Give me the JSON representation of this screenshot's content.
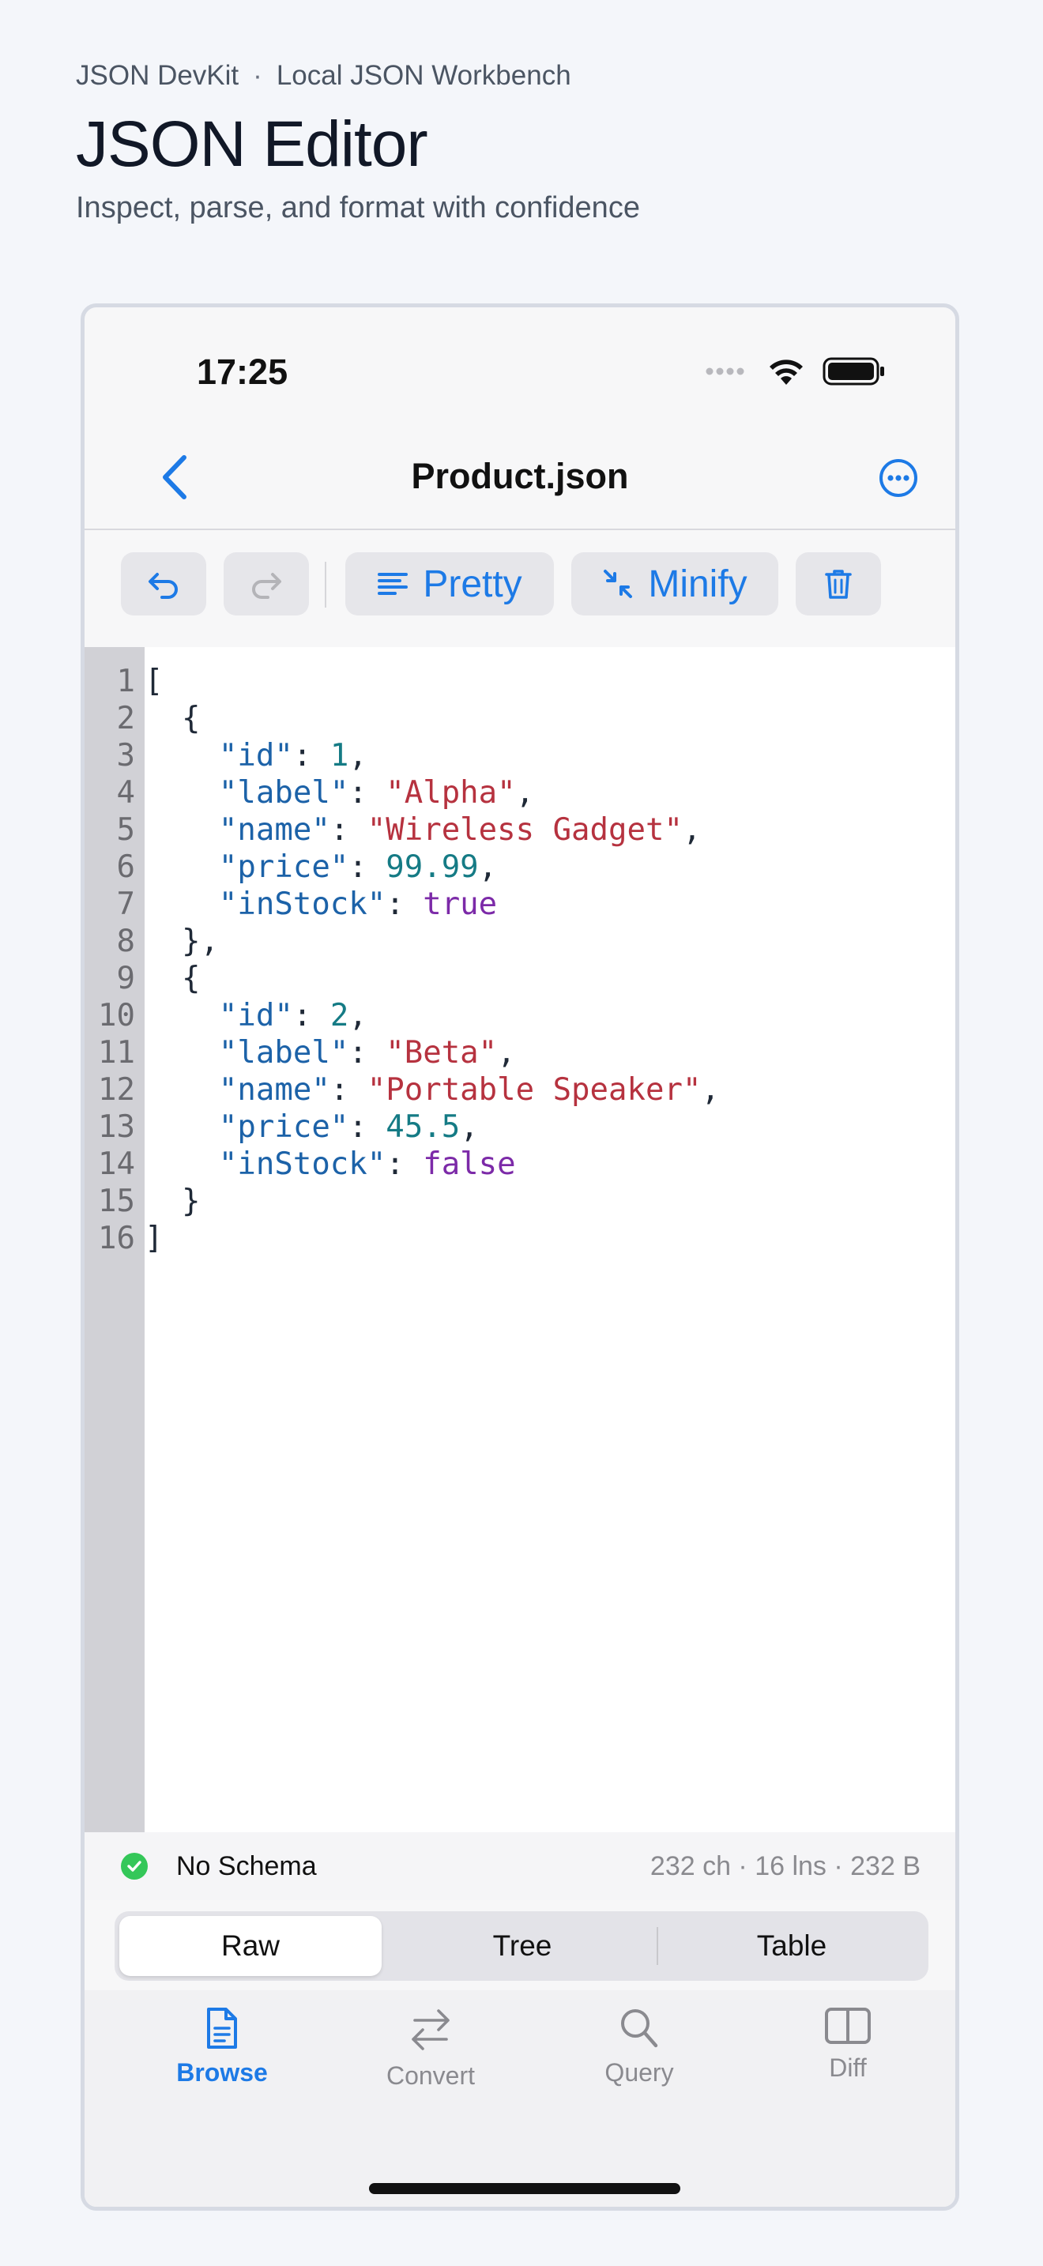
{
  "header": {
    "app_name": "JSON DevKit",
    "separator": "·",
    "section": "Local JSON Workbench",
    "title": "JSON Editor",
    "subtitle": "Inspect, parse, and format with confidence"
  },
  "status_bar": {
    "time": "17:25"
  },
  "nav": {
    "title": "Product.json"
  },
  "toolbar": {
    "pretty_label": "Pretty",
    "minify_label": "Minify"
  },
  "editor": {
    "line_numbers": [
      "1",
      "2",
      "3",
      "4",
      "5",
      "6",
      "7",
      "8",
      "9",
      "10",
      "11",
      "12",
      "13",
      "14",
      "15",
      "16"
    ]
  },
  "footer": {
    "schema_label": "No Schema",
    "stats": "232 ch · 16 lns · 232 B"
  },
  "view_modes": {
    "raw": "Raw",
    "tree": "Tree",
    "table": "Table",
    "selected": "Raw"
  },
  "tabs": {
    "browse": "Browse",
    "convert": "Convert",
    "query": "Query",
    "diff": "Diff",
    "active": "Browse"
  },
  "colors": {
    "accent": "#1d7ae6",
    "success": "#34c759",
    "json_key": "#1c62a8",
    "json_string": "#b6323f",
    "json_number": "#157b85",
    "json_bool": "#7c2aa8"
  }
}
